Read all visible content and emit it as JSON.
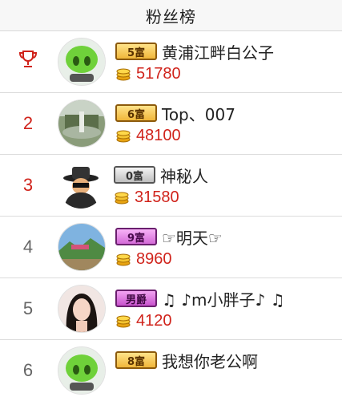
{
  "header": {
    "title": "粉丝榜"
  },
  "rows": [
    {
      "rank": "",
      "badge": "5富",
      "badge_style": "gold",
      "name": "黄浦江畔白公子",
      "score": "51780",
      "avatar": "green-alien-avatar"
    },
    {
      "rank": "2",
      "badge": "6富",
      "badge_style": "gold",
      "name": "Top、007",
      "score": "48100",
      "avatar": "fountain-photo-avatar"
    },
    {
      "rank": "3",
      "badge": "0富",
      "badge_style": "gray",
      "name": "神秘人",
      "score": "31580",
      "avatar": "mystery-hat-avatar"
    },
    {
      "rank": "4",
      "badge": "9富",
      "badge_style": "purple",
      "name": "☞明天☞",
      "score": "8960",
      "avatar": "landscape-photo-avatar"
    },
    {
      "rank": "5",
      "badge": "男爵",
      "badge_style": "male",
      "name": "♫ ♪m小胖子♪ ♫",
      "score": "4120",
      "avatar": "girl-photo-avatar"
    },
    {
      "rank": "6",
      "badge": "8富",
      "badge_style": "gold",
      "name": "我想你老公啊",
      "score": "",
      "avatar": "green-alien-avatar"
    }
  ],
  "colors": {
    "rank_top3": "#d0231b",
    "rank_other": "#666666",
    "score": "#d0231b"
  }
}
